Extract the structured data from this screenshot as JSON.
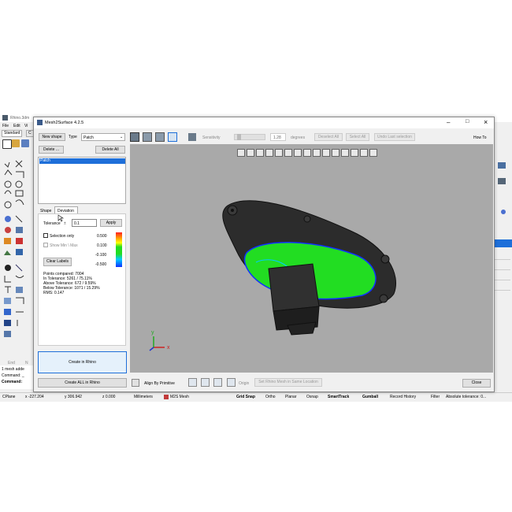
{
  "rhino": {
    "title": "Rhino.3dm",
    "menu": [
      "File",
      "Edit",
      "Vi"
    ],
    "tabs": [
      "Standard",
      "C"
    ],
    "cmd_lines": [
      "1 mesh adde",
      "Command: _",
      "Command:"
    ],
    "end_label": "End",
    "end_label2": "N",
    "status": {
      "cplane": "CPlane",
      "x": "x -227.204",
      "y": "y 306.942",
      "z": "z 0.000",
      "units": "Millimeters",
      "layer": "M2S Mesh",
      "grid_snap": "Grid Snap",
      "ortho": "Ortho",
      "planar": "Planar",
      "osnap": "Osnap",
      "smarttrack": "SmartTrack",
      "gumball": "Gumball",
      "record_history": "Record History",
      "filter": "Filter",
      "abs_tol": "Absolute tolerance: 0..."
    }
  },
  "dialog": {
    "title": "Mesh2Surface 4.2.5",
    "new_shape": "New shape",
    "type_label": "Type",
    "type_value": "Patch",
    "delete": "Delete ...",
    "delete_all": "Delete All",
    "list_items": [
      "Patch"
    ],
    "tabs": [
      "Shape",
      "Deviation"
    ],
    "tolerance_label": "Tolerance",
    "tolerance_value": "0.1",
    "apply": "Apply",
    "selection_only": "Selection only",
    "show_min_max": "Show Min \\ Max",
    "legend": [
      "0.500",
      "0.100",
      "-0.100",
      "-0.500"
    ],
    "clear_labels": "Clear Labels",
    "stats": [
      "Points compared: 7004",
      "In Tolerance: 5261 / 75.11%",
      "Above Tolerance: 672 / 9.59%",
      "Below Tolerance: 1071 / 15.29%",
      "RMS: 0.147"
    ],
    "create_in_rhino": "Create in Rhino",
    "create_all": "Create ALL in Rhino",
    "sensitivity_label": "Sensitivity",
    "sensitivity_value": "1.28",
    "degrees": "degrees",
    "deselect_all": "Deselect All",
    "select_all": "Select All",
    "undo_last": "Undo Last selection",
    "how_to": "How To",
    "align_by_primitive": "Align By Primitive",
    "origin": "Origin",
    "set_mesh_location": "Set Rhino Mesh in Same Location",
    "close": "Close",
    "min_btn": "–",
    "max_btn": "□",
    "close_btn": "×",
    "axis_x": "x",
    "axis_y": "y"
  },
  "colors": {
    "accent": "#1e6fd9",
    "deviation_green": "#22dd22",
    "viewport_bg": "#a9a9a9"
  }
}
